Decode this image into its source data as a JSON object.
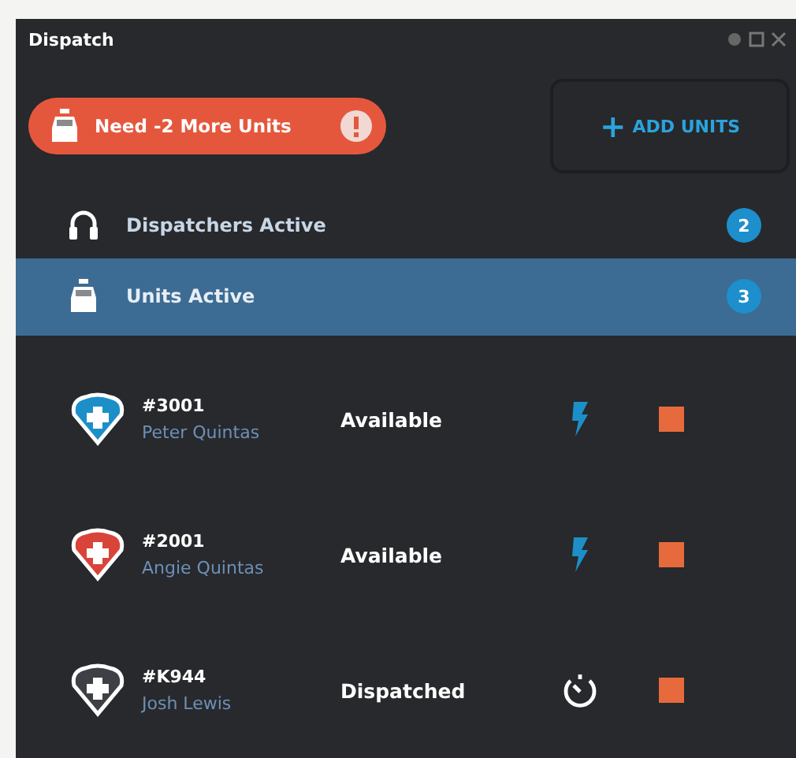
{
  "window": {
    "title": "Dispatch"
  },
  "alert": {
    "label": "Need -2 More Units"
  },
  "add_button": {
    "icon": "+",
    "label": "ADD UNITS"
  },
  "stats": [
    {
      "kind": "dispatchers",
      "label": "Dispatchers Active",
      "count": "2",
      "selected": false
    },
    {
      "kind": "units",
      "label": "Units Active",
      "count": "3",
      "selected": true
    }
  ],
  "units": [
    {
      "number": "#3001",
      "name": "Peter Quintas",
      "status": "Available",
      "color": "#1d8fc8",
      "kind": "ready"
    },
    {
      "number": "#2001",
      "name": "Angie Quintas",
      "status": "Available",
      "color": "#d9443a",
      "kind": "ready"
    },
    {
      "number": "#K944",
      "name": "Josh Lewis",
      "status": "Dispatched",
      "color": "#3e4045",
      "kind": "timer"
    }
  ]
}
